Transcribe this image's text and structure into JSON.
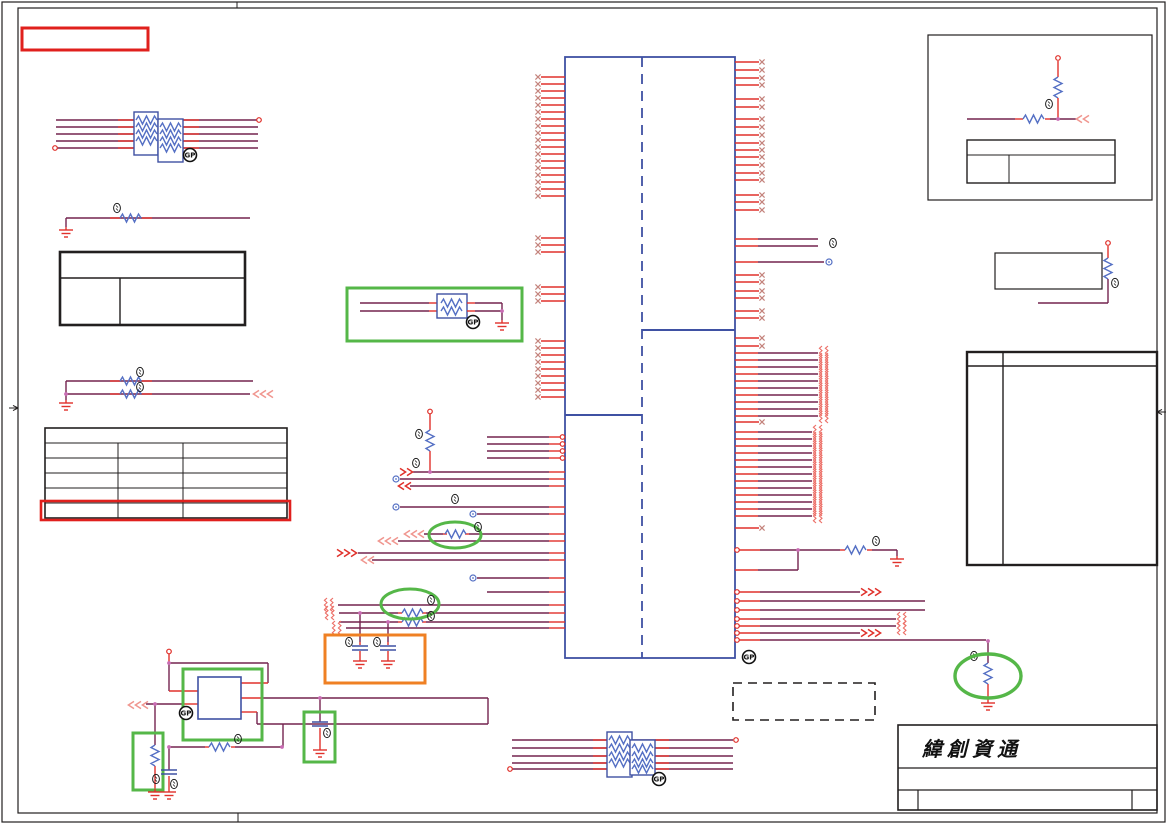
{
  "document": {
    "type": "schematic-page",
    "company_logo_text": "緯創資通"
  },
  "badges": {
    "gp": "GP"
  },
  "colors": {
    "wire_purple": "#74234f",
    "pin_red": "#e0312b",
    "pale_red": "#ef8c85",
    "component_blue": "#3f51a3",
    "resistor_blue": "#5570c4",
    "highlight_green": "#55b748",
    "highlight_orange": "#ef8023",
    "highlight_red": "#e0201d",
    "junction_pink": "#c96cb4",
    "frame_black": "#221f1f"
  }
}
